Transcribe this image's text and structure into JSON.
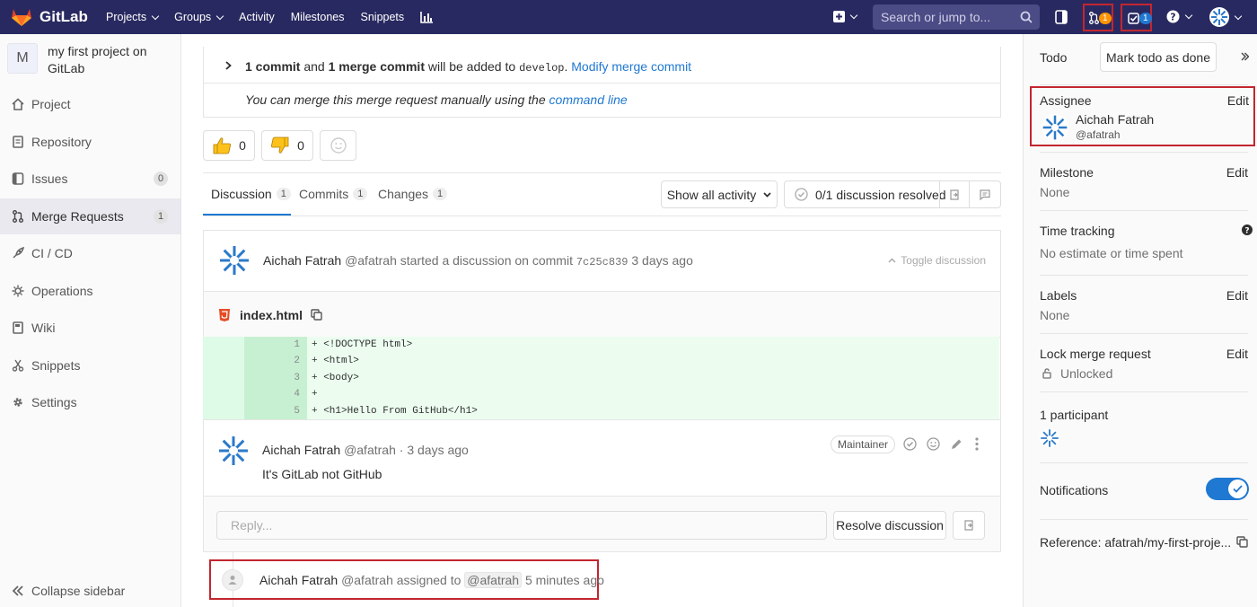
{
  "topnav": {
    "brand": "GitLab",
    "links": [
      "Projects",
      "Groups",
      "Activity",
      "Milestones",
      "Snippets"
    ],
    "search_placeholder": "Search or jump to...",
    "mr_count": "1",
    "todo_count": "1"
  },
  "sidebar": {
    "project_initial": "M",
    "project_name": "my first project on GitLab",
    "items": [
      {
        "label": "Project",
        "icon": "home-icon"
      },
      {
        "label": "Repository",
        "icon": "doc-icon"
      },
      {
        "label": "Issues",
        "icon": "issues-icon",
        "badge": "0"
      },
      {
        "label": "Merge Requests",
        "icon": "merge-icon",
        "badge": "1",
        "active": true
      },
      {
        "label": "CI / CD",
        "icon": "rocket-icon"
      },
      {
        "label": "Operations",
        "icon": "cloud-gear-icon"
      },
      {
        "label": "Wiki",
        "icon": "book-icon"
      },
      {
        "label": "Snippets",
        "icon": "scissors-icon"
      },
      {
        "label": "Settings",
        "icon": "gear-icon"
      }
    ],
    "collapse_label": "Collapse sidebar"
  },
  "merge_box": {
    "c1": "1 commit",
    "and": " and ",
    "c2": "1 merge commit",
    "added": " will be added to ",
    "branch": "develop",
    "dot": ". ",
    "modify": "Modify merge commit",
    "manual_text": "You can merge this merge request manually using the ",
    "command_line": "command line"
  },
  "reactions": {
    "thumbs_up": "0",
    "thumbs_down": "0"
  },
  "tabs": [
    {
      "label": "Discussion",
      "count": "1"
    },
    {
      "label": "Commits",
      "count": "1"
    },
    {
      "label": "Changes",
      "count": "1"
    }
  ],
  "activity_filter": "Show all activity",
  "resolved_text": "0/1 discussion resolved",
  "discussion": {
    "author": "Aichah Fatrah",
    "handle": "@afatrah",
    "started": " started a discussion on commit ",
    "commit": "7c25c839",
    "time": "3 days ago",
    "toggle": "Toggle discussion",
    "file": "index.html",
    "diff": [
      {
        "n": "1",
        "code": "+ <!DOCTYPE html>"
      },
      {
        "n": "2",
        "code": "+ <html>"
      },
      {
        "n": "3",
        "code": "+ <body>"
      },
      {
        "n": "4",
        "code": "+"
      },
      {
        "n": "5",
        "code": "+ <h1>Hello From GitHub</h1>"
      }
    ],
    "note_author": "Aichah Fatrah",
    "note_handle": "@afatrah",
    "note_time": "· 3 days ago",
    "role": "Maintainer",
    "note_body": "It's GitLab not GitHub",
    "reply_placeholder": "Reply...",
    "resolve_label": "Resolve discussion"
  },
  "system_note": {
    "author": "Aichah Fatrah",
    "handle": "@afatrah",
    "action": "assigned to",
    "target": "@afatrah",
    "time": "5 minutes ago"
  },
  "right_sidebar": {
    "todo_label": "Todo",
    "mark_done": "Mark todo as done",
    "assignee_label": "Assignee",
    "edit": "Edit",
    "assignee_name": "Aichah Fatrah",
    "assignee_handle": "@afatrah",
    "milestone_label": "Milestone",
    "milestone_value": "None",
    "time_label": "Time tracking",
    "time_value": "No estimate or time spent",
    "labels_label": "Labels",
    "labels_value": "None",
    "lock_label": "Lock merge request",
    "lock_value": "Unlocked",
    "participants": "1 participant",
    "notifications": "Notifications",
    "reference": "Reference: afatrah/my-first-proje..."
  },
  "colors": {
    "nav": "#292961",
    "link": "#1f78d1",
    "highlight": "#c2262f",
    "toggle": "#1f78d1"
  }
}
